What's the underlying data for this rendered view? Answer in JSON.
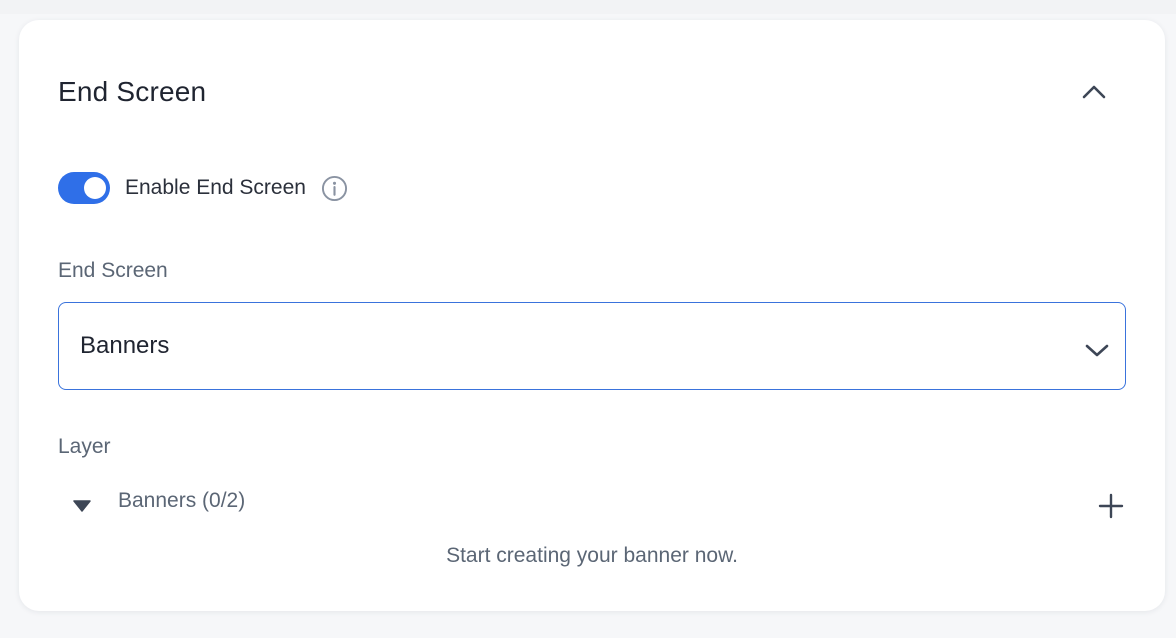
{
  "panel": {
    "title": "End Screen",
    "collapse_icon": "chevron-up-icon"
  },
  "toggle": {
    "label": "Enable End Screen",
    "state": "on",
    "accent_color": "#2f6fe8",
    "info_icon": "info-icon"
  },
  "end_screen_field": {
    "label": "End Screen",
    "selected_value": "Banners",
    "chevron_icon": "chevron-down-icon"
  },
  "layer": {
    "label": "Layer",
    "group_label": "Banners (0/2)",
    "caret_icon": "caret-down-icon",
    "add_icon": "plus-icon",
    "empty_message": "Start creating your banner now."
  }
}
